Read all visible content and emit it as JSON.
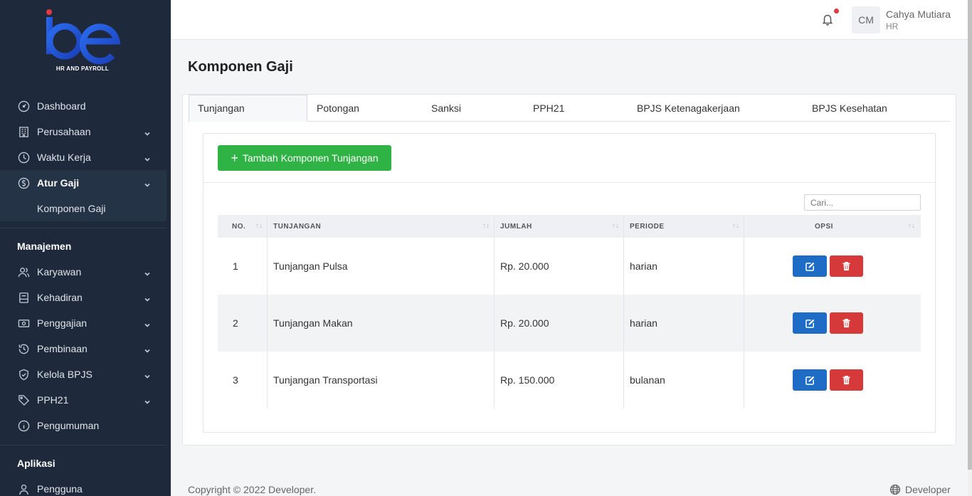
{
  "brand": {
    "logo_text": "be",
    "subtitle": "HR AND PAYROLL"
  },
  "sidebar": {
    "items": [
      {
        "label": "Dashboard",
        "icon": "gauge-icon"
      },
      {
        "label": "Perusahaan",
        "icon": "building-icon"
      },
      {
        "label": "Waktu Kerja",
        "icon": "clock-icon"
      },
      {
        "label": "Atur Gaji",
        "icon": "dollar-icon"
      }
    ],
    "sub_item": "Komponen Gaji",
    "section_manajemen": "Manajemen",
    "manajemen_items": [
      {
        "label": "Karyawan",
        "icon": "users-icon"
      },
      {
        "label": "Kehadiran",
        "icon": "calendar-icon"
      },
      {
        "label": "Penggajian",
        "icon": "cash-icon"
      },
      {
        "label": "Pembinaan",
        "icon": "history-icon"
      },
      {
        "label": "Kelola BPJS",
        "icon": "shield-icon"
      },
      {
        "label": "PPH21",
        "icon": "tag-icon"
      },
      {
        "label": "Pengumuman",
        "icon": "info-icon"
      }
    ],
    "section_aplikasi": "Aplikasi",
    "aplikasi_items": [
      {
        "label": "Pengguna",
        "icon": "user-icon"
      }
    ]
  },
  "topbar": {
    "avatar_initials": "CM",
    "user_name": "Cahya Mutiara",
    "user_role": "HR"
  },
  "page": {
    "title": "Komponen Gaji"
  },
  "tabs": [
    "Tunjangan",
    "Potongan",
    "Sanksi",
    "PPH21",
    "BPJS Ketenagakerjaan",
    "BPJS Kesehatan"
  ],
  "toolbar": {
    "add_label": "Tambah Komponen Tunjangan",
    "search_placeholder": "Cari..."
  },
  "table": {
    "headers": [
      "NO.",
      "TUNJANGAN",
      "JUMLAH",
      "PERIODE",
      "OPSI"
    ],
    "rows": [
      {
        "no": "1",
        "name": "Tunjangan Pulsa",
        "amount": "Rp. 20.000",
        "period": "harian"
      },
      {
        "no": "2",
        "name": "Tunjangan Makan",
        "amount": "Rp. 20.000",
        "period": "harian"
      },
      {
        "no": "3",
        "name": "Tunjangan Transportasi",
        "amount": "Rp. 150.000",
        "period": "bulanan"
      }
    ]
  },
  "footer": {
    "copyright": "Copyright © 2022 Developer.",
    "link": "Developer"
  },
  "colors": {
    "sidebar": "#1e2a3b",
    "add_button": "#2fb344",
    "edit_button": "#1f6cc6",
    "delete_button": "#d63939"
  }
}
